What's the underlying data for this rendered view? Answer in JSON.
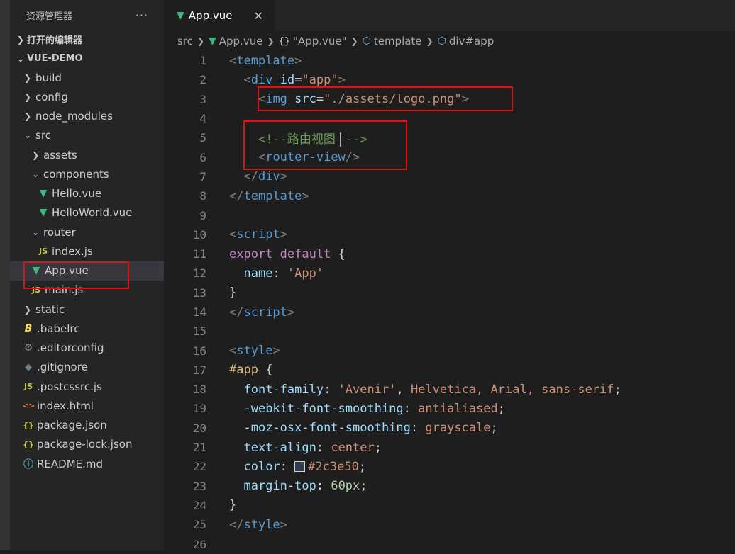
{
  "sidebar": {
    "title": "资源管理器",
    "more": "···",
    "open_editors": "打开的编辑器",
    "project": "VUE-DEMO",
    "items": [
      {
        "label": "build",
        "icon": "chevron-right-icon",
        "depth": 1
      },
      {
        "label": "config",
        "icon": "chevron-right-icon",
        "depth": 1
      },
      {
        "label": "node_modules",
        "icon": "chevron-right-icon",
        "depth": 1
      },
      {
        "label": "src",
        "icon": "chevron-down-icon",
        "depth": 1
      },
      {
        "label": "assets",
        "icon": "chevron-right-icon",
        "depth": 2
      },
      {
        "label": "components",
        "icon": "chevron-down-icon",
        "depth": 2
      },
      {
        "label": "Hello.vue",
        "icon": "vue-file-icon",
        "depth": 3
      },
      {
        "label": "HelloWorld.vue",
        "icon": "vue-file-icon",
        "depth": 3
      },
      {
        "label": "router",
        "icon": "chevron-down-icon",
        "depth": 2
      },
      {
        "label": "index.js",
        "icon": "js-file-icon",
        "depth": 3
      },
      {
        "label": "App.vue",
        "icon": "vue-file-icon",
        "depth": 2
      },
      {
        "label": "main.js",
        "icon": "js-file-icon",
        "depth": 2
      },
      {
        "label": "static",
        "icon": "chevron-right-icon",
        "depth": 1
      },
      {
        "label": ".babelrc",
        "icon": "babel-file-icon",
        "depth": 1
      },
      {
        "label": ".editorconfig",
        "icon": "gear-icon",
        "depth": 1
      },
      {
        "label": ".gitignore",
        "icon": "git-icon",
        "depth": 1
      },
      {
        "label": ".postcssrc.js",
        "icon": "js-file-icon",
        "depth": 1
      },
      {
        "label": "index.html",
        "icon": "html-file-icon",
        "depth": 1
      },
      {
        "label": "package.json",
        "icon": "json-file-icon",
        "depth": 1
      },
      {
        "label": "package-lock.json",
        "icon": "json-file-icon",
        "depth": 1
      },
      {
        "label": "README.md",
        "icon": "info-icon",
        "depth": 1
      }
    ]
  },
  "tab": {
    "label": "App.vue",
    "close": "✕"
  },
  "breadcrumb": {
    "items": [
      "src",
      "App.vue",
      "\"App.vue\"",
      "template",
      "div#app"
    ]
  },
  "code": {
    "line_numbers": [
      "1",
      "2",
      "3",
      "4",
      "5",
      "6",
      "7",
      "8",
      "9",
      "10",
      "11",
      "12",
      "13",
      "14",
      "15",
      "16",
      "17",
      "18",
      "19",
      "20",
      "21",
      "22",
      "23",
      "24",
      "25",
      "26"
    ],
    "l1_tag": "template",
    "l2_tag": "div",
    "l2_attr": "id",
    "l2_val": "\"app\"",
    "l3_tag": "img",
    "l3_attr": "src",
    "l3_val": "\"./assets/logo.png\"",
    "l5_cmt_open": "<!--路由视图",
    "l5_cmt_close": "-->",
    "l6_tag": "router-view",
    "l7_tag": "div",
    "l8_tag": "template",
    "l10_tag": "script",
    "l11_kw1": "export",
    "l11_kw2": "default",
    "l11_brace": "{",
    "l12_key": "name",
    "l12_val": "'App'",
    "l13_brace": "}",
    "l14_tag": "script",
    "l16_tag": "style",
    "l17_sel": "#app",
    "l17_brace": "{",
    "l18_prop": "font-family",
    "l18_v1": "'Avenir'",
    "l18_v2": "Helvetica, Arial, sans-serif",
    "l19_prop": "-webkit-font-smoothing",
    "l19_val": "antialiased",
    "l20_prop": "-moz-osx-font-smoothing",
    "l20_val": "grayscale",
    "l21_prop": "text-align",
    "l21_val": "center",
    "l22_prop": "color",
    "l22_val": "#2c3e50",
    "l23_prop": "margin-top",
    "l23_val": "60px",
    "l24_brace": "}",
    "l25_tag": "style"
  },
  "colors": {
    "highlight_box": "#e01010",
    "swatch": "#2c3e50"
  }
}
